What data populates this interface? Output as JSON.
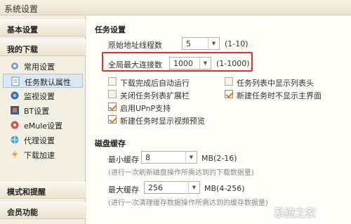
{
  "window": {
    "title": "系统设置"
  },
  "sidebar": {
    "sections": [
      {
        "label": "基本设置"
      },
      {
        "label": "我的下载"
      },
      {
        "label": "模式和提醒"
      },
      {
        "label": "会员功能"
      }
    ],
    "items": [
      {
        "label": "常用设置",
        "icon": "gear-icon"
      },
      {
        "label": "任务默认属性",
        "icon": "document-icon"
      },
      {
        "label": "监视设置",
        "icon": "monitor-icon"
      },
      {
        "label": "BT设置",
        "icon": "bt-icon"
      },
      {
        "label": "eMule设置",
        "icon": "emule-icon"
      },
      {
        "label": "代理设置",
        "icon": "proxy-globe-icon"
      },
      {
        "label": "下载加速",
        "icon": "lightning-icon"
      }
    ]
  },
  "task": {
    "heading": "任务设置",
    "origin_threads_label": "原始地址线程数",
    "origin_threads_value": "5",
    "origin_threads_range": "(1-10)",
    "max_conn_label": "全局最大连接数",
    "max_conn_value": "1000",
    "max_conn_range": "(1-1000)",
    "checkboxes": [
      {
        "label": "下载完成后自动运行",
        "checked": false
      },
      {
        "label": "任务列表中显示列表头",
        "checked": false
      },
      {
        "label": "关闭任务列表扩展栏",
        "checked": false
      },
      {
        "label": "新建任务时不显示主界面",
        "checked": true
      },
      {
        "label": "启用UPnP支持",
        "checked": true
      },
      {
        "label": "新建任务时显示视频预览",
        "checked": true
      }
    ]
  },
  "disk": {
    "heading": "磁盘缓存",
    "min_label": "最小缓存",
    "min_value": "8",
    "min_unit": "MB(2-16)",
    "min_hint": "(进行一次刷新磁盘操作所需达到的下载数据量)",
    "max_label": "最大缓存",
    "max_value": "256",
    "max_unit": "MB(4-256)",
    "max_hint": "(进行一次清理缓存数据操作所需达到的缓存数据量)"
  },
  "watermark": "系统之家",
  "colors": {
    "highlight": "#e52d2d",
    "check": "#e0761c",
    "active_item": "#dbe7f3"
  }
}
